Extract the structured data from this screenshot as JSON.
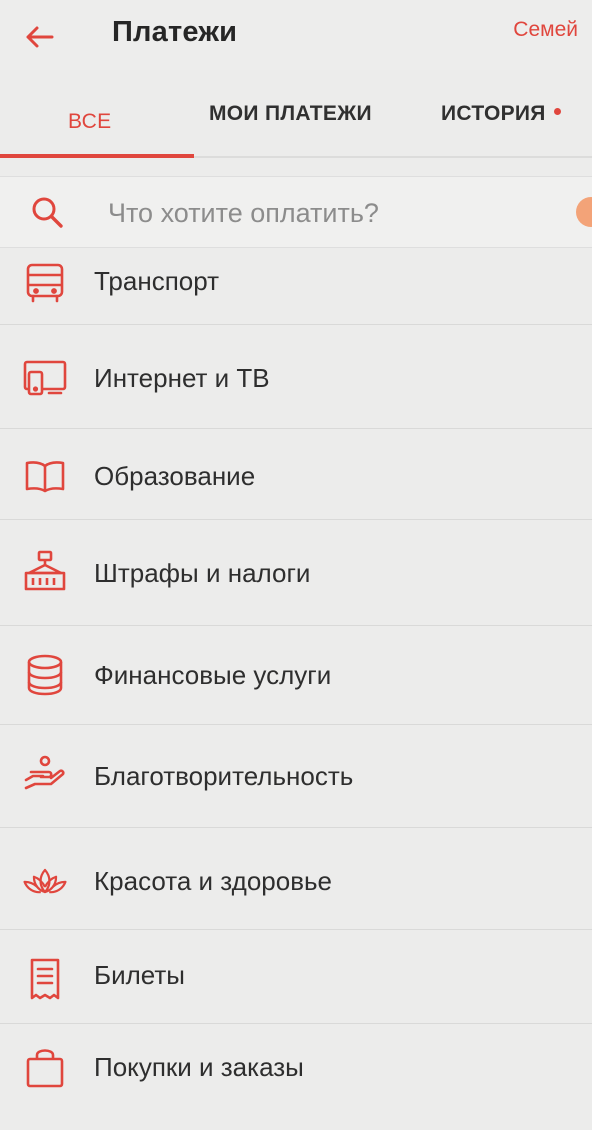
{
  "header": {
    "title": "Платежи",
    "action_label": "Семей",
    "back_icon": "arrow-left-icon",
    "accent_color": "#e0463d"
  },
  "tabs": [
    {
      "label": "ВСЕ",
      "active": true
    },
    {
      "label": "МОИ ПЛАТЕЖИ",
      "active": false
    },
    {
      "label": "ИСТОРИЯ",
      "active": false,
      "has_dot": true
    }
  ],
  "search": {
    "placeholder": "Что хотите оплатить?",
    "value": "",
    "icon": "search-icon"
  },
  "categories": [
    {
      "label": "Транспорт",
      "icon": "bus-icon"
    },
    {
      "label": "Интернет и ТВ",
      "icon": "devices-icon"
    },
    {
      "label": "Образование",
      "icon": "book-icon"
    },
    {
      "label": "Штрафы и налоги",
      "icon": "government-building-icon"
    },
    {
      "label": "Финансовые услуги",
      "icon": "coins-stack-icon"
    },
    {
      "label": "Благотворительность",
      "icon": "charity-hand-icon"
    },
    {
      "label": "Красота и здоровье",
      "icon": "lotus-icon"
    },
    {
      "label": "Билеты",
      "icon": "ticket-icon"
    },
    {
      "label": "Покупки и заказы",
      "icon": "shopping-bag-icon"
    }
  ]
}
